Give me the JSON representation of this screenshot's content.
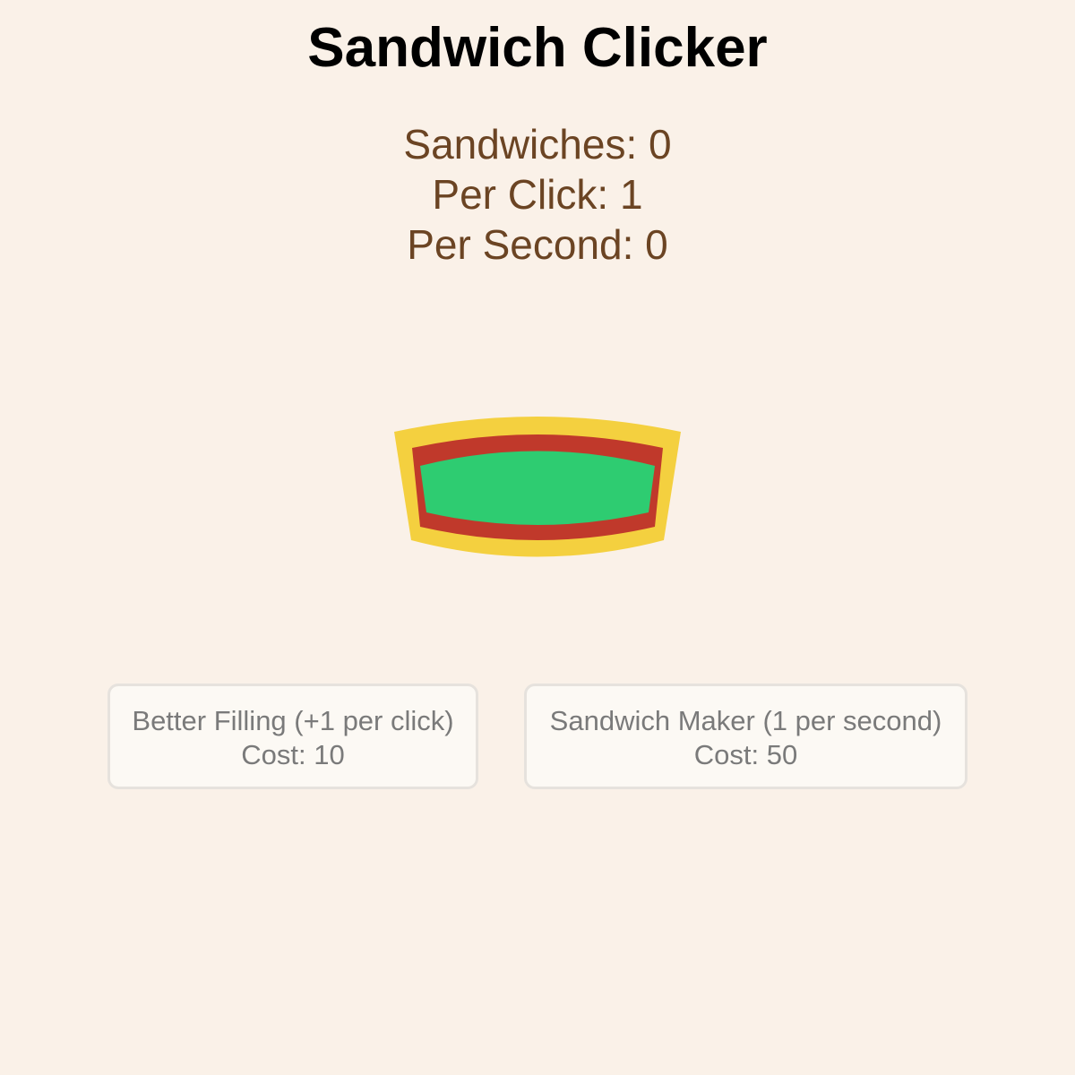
{
  "game": {
    "title": "Sandwich Clicker"
  },
  "stats": {
    "sandwiches": "Sandwiches: 0",
    "per_click": "Per Click: 1",
    "per_second": "Per Second: 0"
  },
  "sandwich_button": {
    "icon": "sandwich-icon",
    "colors": {
      "bread": "#f4d03f",
      "sauce": "#c0392b",
      "lettuce": "#2ecc71"
    }
  },
  "upgrades": [
    {
      "name": "Better Filling (+1 per click)",
      "cost": "Cost: 10"
    },
    {
      "name": "Sandwich Maker (1 per second)",
      "cost": "Cost: 50"
    }
  ]
}
